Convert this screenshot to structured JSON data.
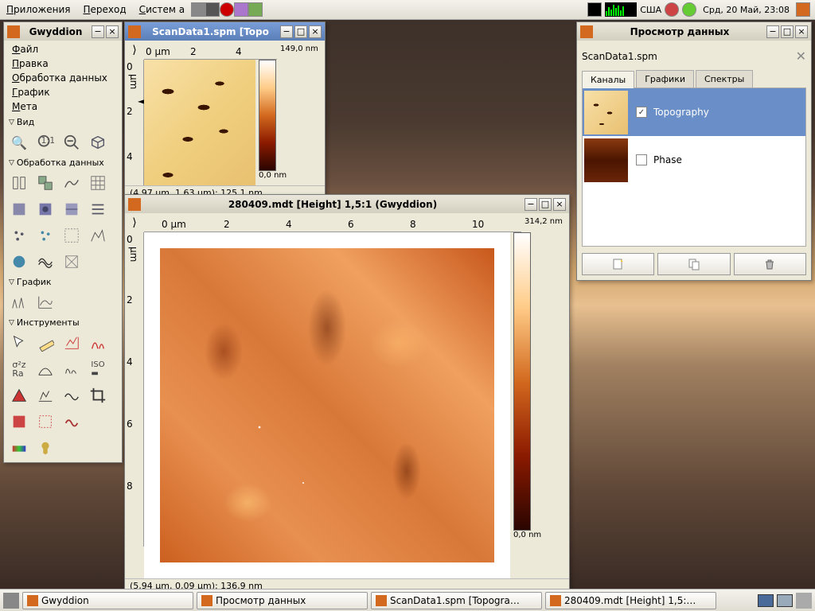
{
  "top_panel": {
    "menus": [
      "Приложения",
      "Переход",
      "Систем а"
    ],
    "keyboard": "США",
    "clock": "Срд, 20 Май, 23:08"
  },
  "gwy": {
    "title": "Gwyddion",
    "menu": [
      "Файл",
      "Правка",
      "Обработка данных",
      "График",
      "Мета"
    ],
    "sections": {
      "view": "Вид",
      "proc": "Обработка данных",
      "graph": "График",
      "tools": "Инструменты"
    }
  },
  "scan1": {
    "title": "ScanData1.spm [Topo",
    "h_ticks": [
      "0 µm",
      "2",
      "4"
    ],
    "v_unit": "µm",
    "cmax": "149,0 nm",
    "cmin": "0,0 nm",
    "status": "(4,97 µm, 1,63 µm): 125,1 nm"
  },
  "scan2": {
    "title": "280409.mdt [Height] 1,5:1 (Gwyddion)",
    "h_ticks": [
      "0 µm",
      "2",
      "4",
      "6",
      "8",
      "10"
    ],
    "v_ticks": [
      "0",
      "2",
      "4",
      "6",
      "8"
    ],
    "v_unit": "µm",
    "cmax": "314,2 nm",
    "cmin": "0,0 nm",
    "status": "(5,94 µm, 0,09 µm): 136,9 nm"
  },
  "browser": {
    "title": "Просмотр данных",
    "filename": "ScanData1.spm",
    "tabs": [
      "Каналы",
      "Графики",
      "Спектры"
    ],
    "channels": [
      {
        "label": "Topography",
        "checked": true
      },
      {
        "label": "Phase",
        "checked": false
      }
    ]
  },
  "taskbar": [
    "Gwyddion",
    "Просмотр данных",
    "ScanData1.spm [Topogra…",
    "280409.mdt [Height] 1,5:…"
  ]
}
